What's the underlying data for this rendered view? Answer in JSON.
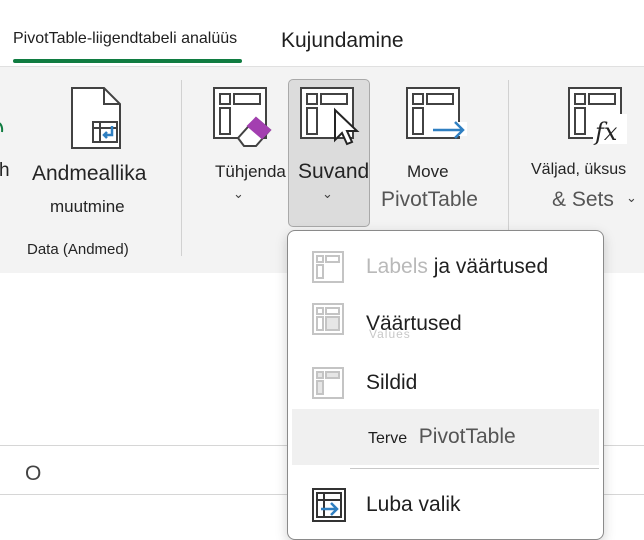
{
  "tabs": {
    "analyze": "PivotTable-liigendtabeli analüüs",
    "design": "Kujundamine"
  },
  "ribbon": {
    "cut_h": "h",
    "change_source": {
      "line1": "Andmeallika",
      "line2": "muutmine"
    },
    "group_data": "Data (Andmed)",
    "clear": {
      "label": "Tühjenda",
      "chevron": "⌄"
    },
    "select": {
      "label": "Suvand",
      "chevron": "⌄"
    },
    "move": {
      "line1": "Move",
      "line2": "PivotTable"
    },
    "fields": {
      "line1": "Väljad, üksus",
      "line2": "& Sets",
      "chevron": "⌄"
    }
  },
  "sheet": {
    "column": "O"
  },
  "menu": {
    "items": [
      {
        "ghost": "Labels",
        "label": "ja väärtused"
      },
      {
        "label": "Väärtused",
        "ghost": "Values"
      },
      {
        "label": "Sildid"
      },
      {
        "small": "Terve",
        "label": "PivotTable"
      },
      {
        "label": "Luba valik"
      }
    ]
  },
  "colors": {
    "accent_green": "#107c41",
    "purple": "#a33fb0",
    "blue": "#2f7fc1"
  }
}
